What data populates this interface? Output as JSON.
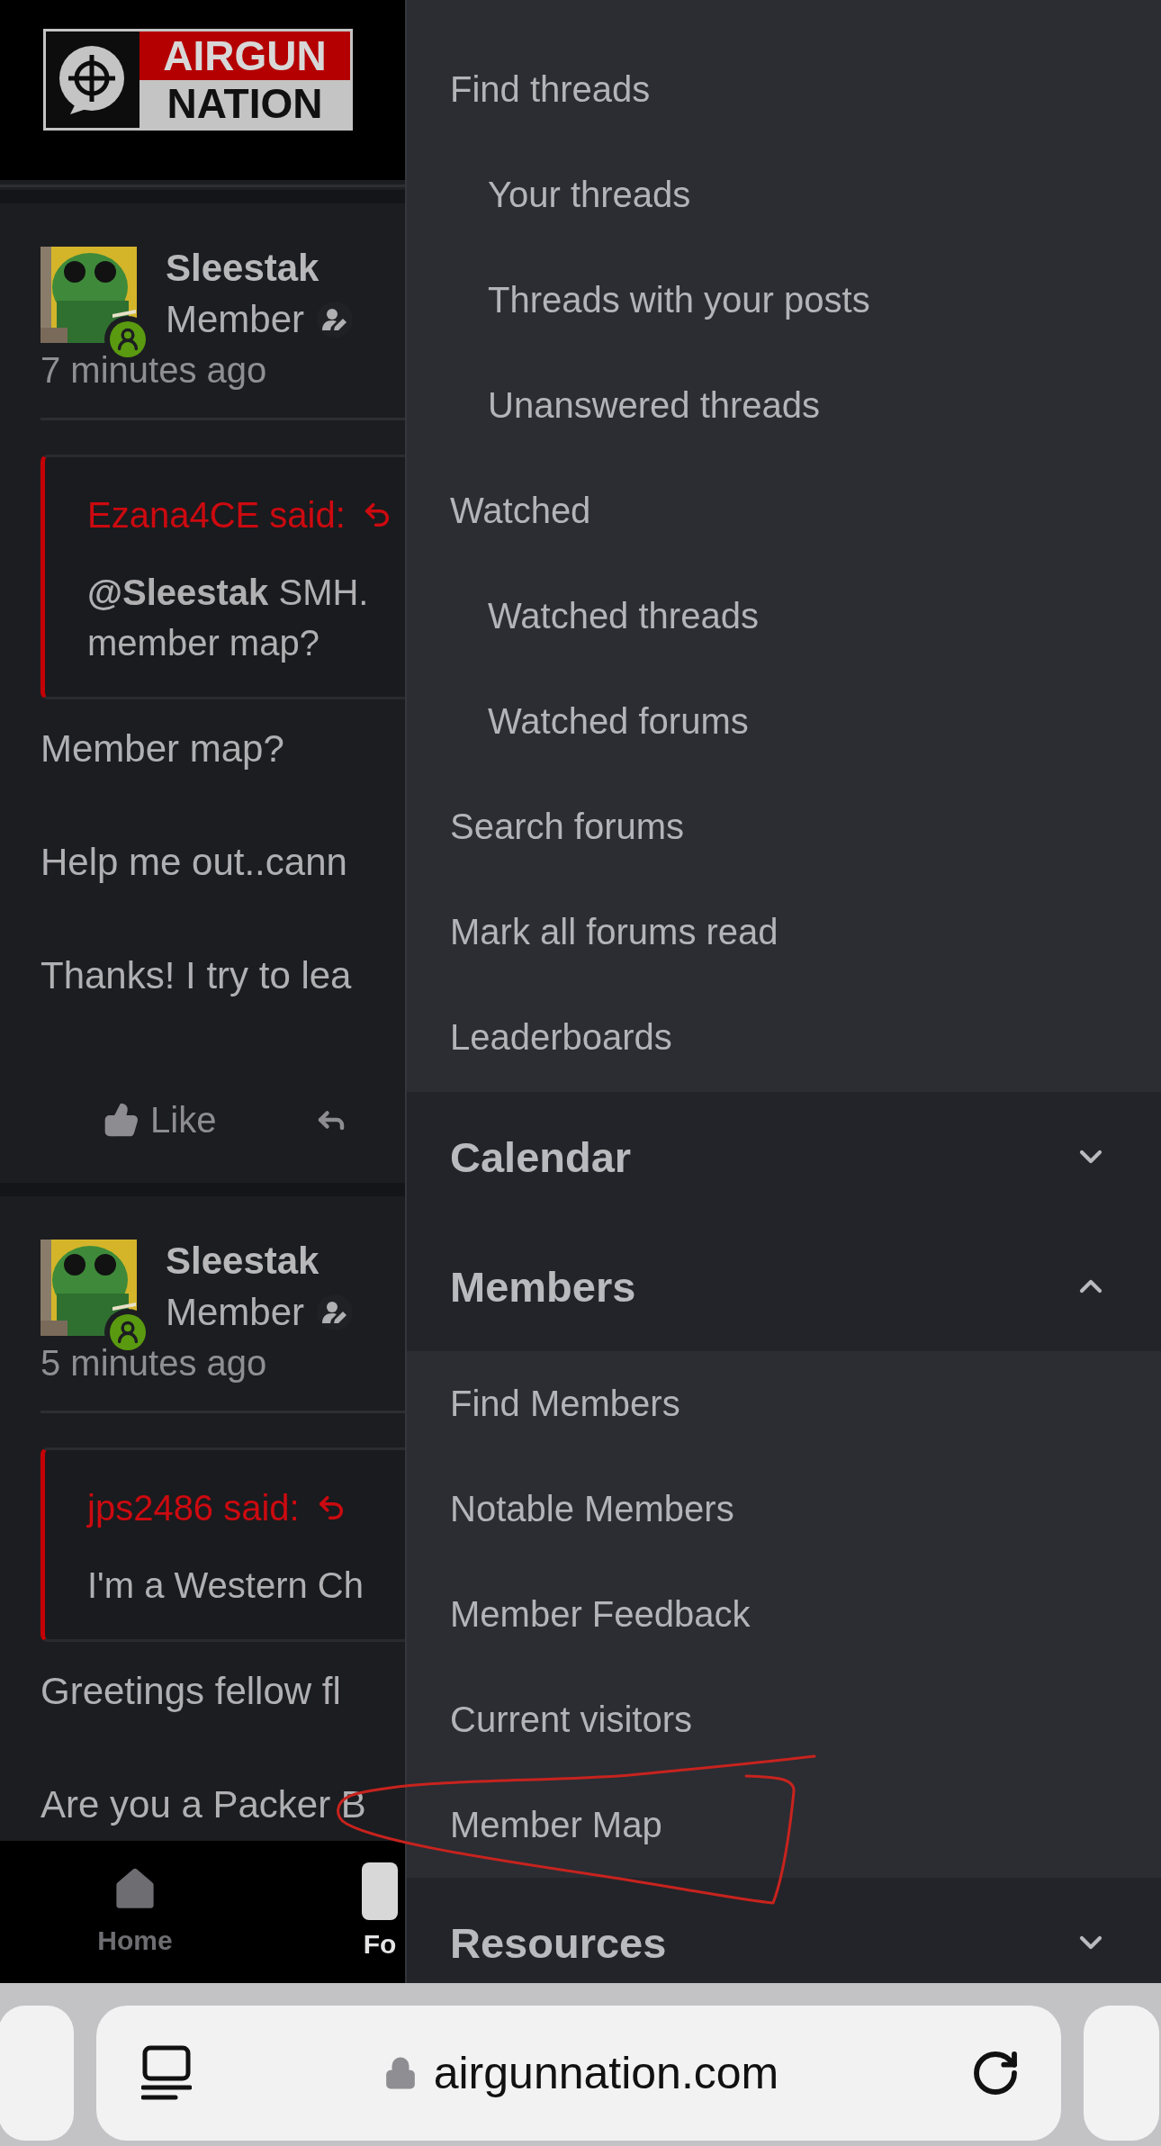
{
  "header": {
    "logo": {
      "line_1": "AIRGUN",
      "line_2": "NATION"
    }
  },
  "posts": [
    {
      "author": "Sleestak",
      "role": "Member",
      "time": "7 minutes ago",
      "quote": {
        "author_line": "Ezana4CE said:",
        "lines": [
          "**@Sleestak** SMH.",
          "member map?"
        ]
      },
      "paragraphs": [
        "Member map?",
        "Help me out..cann",
        "Thanks! I try to lea"
      ],
      "actions": [
        {
          "kind": "like",
          "label": "Like"
        },
        {
          "kind": "reply"
        }
      ]
    },
    {
      "author": "Sleestak",
      "role": "Member",
      "time": "5 minutes ago",
      "quote": {
        "author_line": "jps2486 said:",
        "lines": [
          "I'm a Western Ch"
        ]
      },
      "paragraphs": [
        "Greetings fellow fl",
        "Are you a Packer B"
      ]
    }
  ],
  "bottom_nav": [
    {
      "kind": "home",
      "label": "Home",
      "selected": false
    },
    {
      "kind": "forums",
      "label": "Fo",
      "selected": true
    }
  ],
  "drawer": {
    "links": [
      {
        "label": "Find threads",
        "children": [
          {
            "label": "Your threads"
          },
          {
            "label": "Threads with your posts"
          },
          {
            "label": "Unanswered threads"
          }
        ]
      },
      {
        "label": "Watched",
        "children": [
          {
            "label": "Watched threads"
          },
          {
            "label": "Watched forums"
          }
        ]
      },
      {
        "label": "Search forums"
      },
      {
        "label": "Mark all forums read"
      },
      {
        "label": "Leaderboards"
      }
    ],
    "sections": [
      {
        "label": "Calendar",
        "expanded": false
      },
      {
        "label": "Members",
        "expanded": true,
        "items": [
          {
            "label": "Find Members"
          },
          {
            "label": "Notable Members"
          },
          {
            "label": "Member Feedback"
          },
          {
            "label": "Current visitors"
          },
          {
            "label": "Member Map"
          }
        ]
      },
      {
        "label": "Resources",
        "expanded": false
      }
    ]
  },
  "browser": {
    "url": "airgunnation.com"
  }
}
